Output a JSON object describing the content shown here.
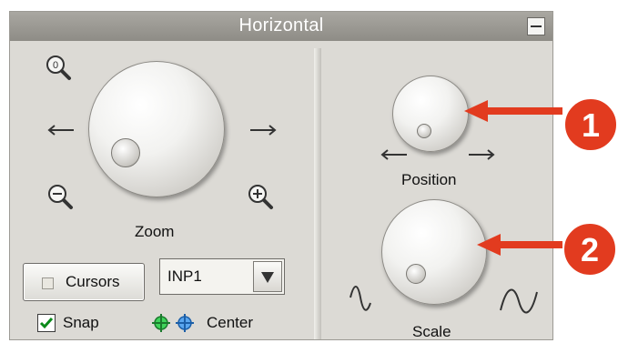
{
  "panel": {
    "title": "Horizontal",
    "minimize_icon": "minus-box-icon"
  },
  "left": {
    "zoom_label": "Zoom",
    "icons": [
      "zoom-reset-icon",
      "zoom-out-icon",
      "zoom-in-icon",
      "arrow-left-icon",
      "arrow-right-icon"
    ],
    "cursors_label": "Cursors",
    "input_select_value": "INP1",
    "snap_label": "Snap",
    "snap_checked": true,
    "center_label": "Center"
  },
  "right": {
    "position_label": "Position",
    "scale_label": "Scale",
    "icons": [
      "arrow-left-icon",
      "arrow-right-icon",
      "wave-small-icon",
      "wave-large-icon"
    ]
  },
  "callouts": {
    "one": "1",
    "two": "2",
    "color": "#e23b1f"
  }
}
